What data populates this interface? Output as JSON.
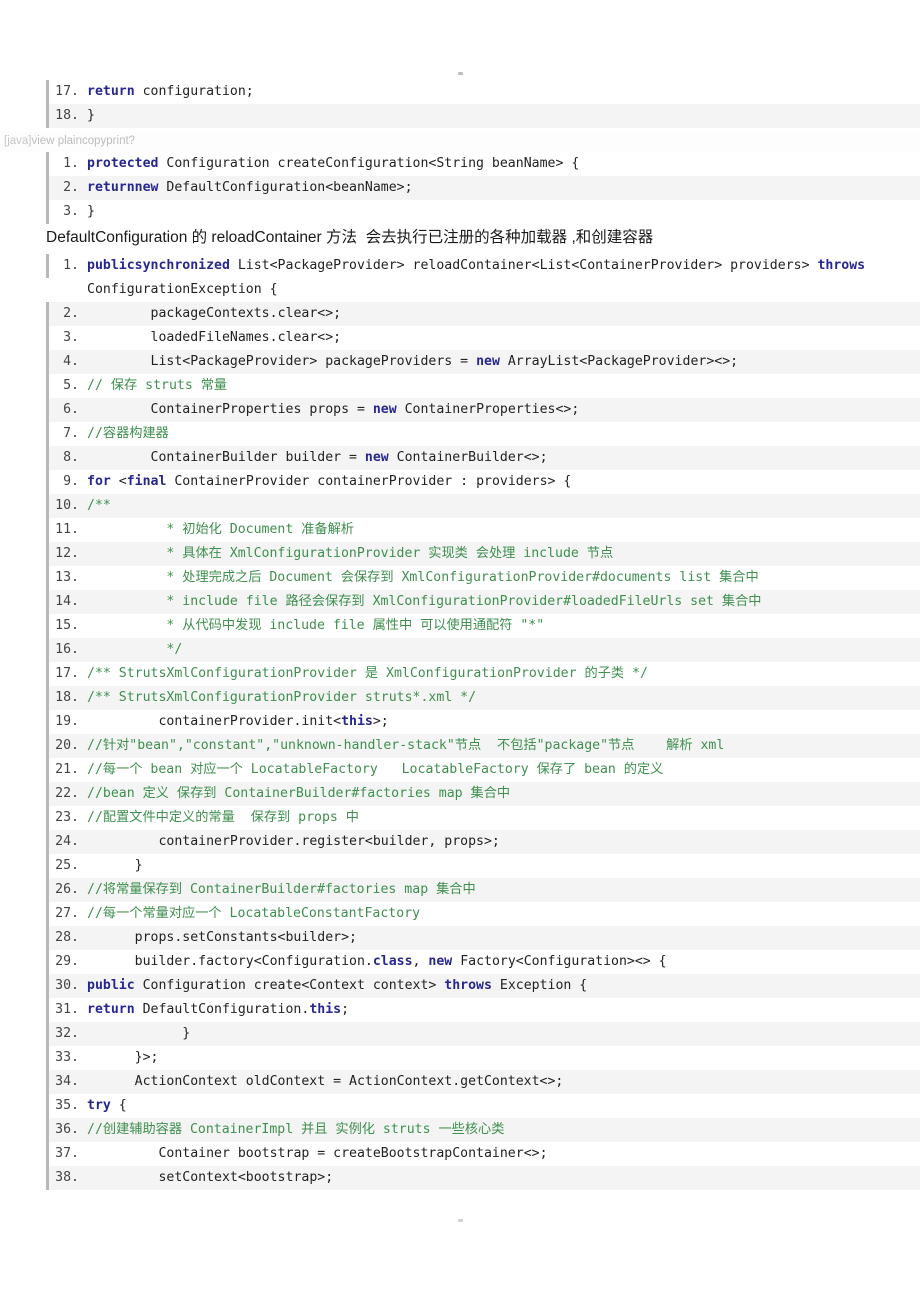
{
  "page": {
    "artifact_top": "·",
    "artifact_bottom": "·"
  },
  "block_a": {
    "rows": [
      {
        "n": "17.",
        "parts": [
          {
            "t": "kw",
            "s": "return"
          },
          {
            "t": "pl",
            "s": " configuration;"
          }
        ]
      },
      {
        "n": "18.",
        "parts": [
          {
            "t": "pl",
            "s": "}"
          }
        ]
      }
    ]
  },
  "toolbar": {
    "lang_label": "[java]",
    "actions_label": "view plaincopyprint?"
  },
  "block_b": {
    "rows": [
      {
        "n": "1.",
        "parts": [
          {
            "t": "kw",
            "s": "protected"
          },
          {
            "t": "pl",
            "s": " Configuration createConfiguration<String beanName> {"
          }
        ]
      },
      {
        "n": "2.",
        "parts": [
          {
            "t": "kw",
            "s": "returnnew"
          },
          {
            "t": "pl",
            "s": " DefaultConfiguration<beanName>;"
          }
        ]
      },
      {
        "n": "3.",
        "parts": [
          {
            "t": "pl",
            "s": "}"
          }
        ]
      }
    ]
  },
  "paragraph": {
    "text": "DefaultConfiguration 的 reloadContainer 方法  会去执行已注册的各种加载器 ,和创建容器"
  },
  "block_c": {
    "rows": [
      {
        "n": "1.",
        "parts": [
          {
            "t": "kw",
            "s": "publicsynchronized"
          },
          {
            "t": "pl",
            "s": " List<PackageProvider> reloadContainer<List<ContainerProvider> providers> "
          },
          {
            "t": "kw",
            "s": "throws"
          },
          {
            "t": "pl",
            "s": " ConfigurationException {"
          }
        ]
      },
      {
        "n": "2.",
        "parts": [
          {
            "t": "pl",
            "s": "        packageContexts.clear<>;"
          }
        ]
      },
      {
        "n": "3.",
        "parts": [
          {
            "t": "pl",
            "s": "        loadedFileNames.clear<>;"
          }
        ]
      },
      {
        "n": "4.",
        "parts": [
          {
            "t": "pl",
            "s": "        List<PackageProvider> packageProviders = "
          },
          {
            "t": "kw",
            "s": "new"
          },
          {
            "t": "pl",
            "s": " ArrayList<PackageProvider><>;"
          }
        ]
      },
      {
        "n": "5.",
        "parts": [
          {
            "t": "cm",
            "s": "// 保存 struts 常量"
          }
        ]
      },
      {
        "n": "6.",
        "parts": [
          {
            "t": "pl",
            "s": "        ContainerProperties props = "
          },
          {
            "t": "kw",
            "s": "new"
          },
          {
            "t": "pl",
            "s": " ContainerProperties<>;"
          }
        ]
      },
      {
        "n": "7.",
        "parts": [
          {
            "t": "cm",
            "s": "//容器构建器"
          }
        ]
      },
      {
        "n": "8.",
        "parts": [
          {
            "t": "pl",
            "s": "        ContainerBuilder builder = "
          },
          {
            "t": "kw",
            "s": "new"
          },
          {
            "t": "pl",
            "s": " ContainerBuilder<>;"
          }
        ]
      },
      {
        "n": "9.",
        "parts": [
          {
            "t": "kw",
            "s": "for"
          },
          {
            "t": "pl",
            "s": " <"
          },
          {
            "t": "kw",
            "s": "final"
          },
          {
            "t": "pl",
            "s": " ContainerProvider containerProvider : providers> {"
          }
        ]
      },
      {
        "n": "10.",
        "parts": [
          {
            "t": "cm",
            "s": "/**"
          }
        ]
      },
      {
        "n": "11.",
        "parts": [
          {
            "t": "cm",
            "s": "          * 初始化 Document 准备解析"
          }
        ]
      },
      {
        "n": "12.",
        "parts": [
          {
            "t": "cm",
            "s": "          * 具体在 XmlConfigurationProvider 实现类 会处理 include 节点"
          }
        ]
      },
      {
        "n": "13.",
        "parts": [
          {
            "t": "cm",
            "s": "          * 处理完成之后 Document 会保存到 XmlConfigurationProvider#documents list 集合中"
          }
        ]
      },
      {
        "n": "14.",
        "parts": [
          {
            "t": "cm",
            "s": "          * include file 路径会保存到 XmlConfigurationProvider#loadedFileUrls set 集合中"
          }
        ]
      },
      {
        "n": "15.",
        "parts": [
          {
            "t": "cm",
            "s": "          * 从代码中发现 include file 属性中 可以使用通配符 \"*\""
          }
        ]
      },
      {
        "n": "16.",
        "parts": [
          {
            "t": "cm",
            "s": "          */"
          }
        ]
      },
      {
        "n": "17.",
        "parts": [
          {
            "t": "cm",
            "s": "/** StrutsXmlConfigurationProvider 是 XmlConfigurationProvider 的子类 */"
          }
        ]
      },
      {
        "n": "18.",
        "parts": [
          {
            "t": "cm",
            "s": "/** StrutsXmlConfigurationProvider struts*.xml */"
          }
        ]
      },
      {
        "n": "19.",
        "parts": [
          {
            "t": "pl",
            "s": "         containerProvider.init<"
          },
          {
            "t": "kw",
            "s": "this"
          },
          {
            "t": "pl",
            "s": ">;"
          }
        ]
      },
      {
        "n": "20.",
        "parts": [
          {
            "t": "cm",
            "s": "//针对\"bean\",\"constant\",\"unknown-handler-stack\"节点  不包括\"package\"节点    解析 xml"
          }
        ]
      },
      {
        "n": "21.",
        "parts": [
          {
            "t": "cm",
            "s": "//每一个 bean 对应一个 LocatableFactory   LocatableFactory 保存了 bean 的定义"
          }
        ]
      },
      {
        "n": "22.",
        "parts": [
          {
            "t": "cm",
            "s": "//bean 定义 保存到 ContainerBuilder#factories map 集合中"
          }
        ]
      },
      {
        "n": "23.",
        "parts": [
          {
            "t": "cm",
            "s": "//配置文件中定义的常量  保存到 props 中"
          }
        ]
      },
      {
        "n": "24.",
        "parts": [
          {
            "t": "pl",
            "s": "         containerProvider.register<builder, props>;"
          }
        ]
      },
      {
        "n": "25.",
        "parts": [
          {
            "t": "pl",
            "s": "      }"
          }
        ]
      },
      {
        "n": "26.",
        "parts": [
          {
            "t": "cm",
            "s": "//将常量保存到 ContainerBuilder#factories map 集合中"
          }
        ]
      },
      {
        "n": "27.",
        "parts": [
          {
            "t": "cm",
            "s": "//每一个常量对应一个 LocatableConstantFactory"
          }
        ]
      },
      {
        "n": "28.",
        "parts": [
          {
            "t": "pl",
            "s": "      props.setConstants<builder>;"
          }
        ]
      },
      {
        "n": "29.",
        "parts": [
          {
            "t": "pl",
            "s": "      builder.factory<Configuration."
          },
          {
            "t": "kw",
            "s": "class"
          },
          {
            "t": "pl",
            "s": ", "
          },
          {
            "t": "kw",
            "s": "new"
          },
          {
            "t": "pl",
            "s": " Factory<Configuration><> {"
          }
        ]
      },
      {
        "n": "30.",
        "parts": [
          {
            "t": "kw",
            "s": "public"
          },
          {
            "t": "pl",
            "s": " Configuration create<Context context> "
          },
          {
            "t": "kw",
            "s": "throws"
          },
          {
            "t": "pl",
            "s": " Exception {"
          }
        ]
      },
      {
        "n": "31.",
        "parts": [
          {
            "t": "kw",
            "s": "return"
          },
          {
            "t": "pl",
            "s": " DefaultConfiguration."
          },
          {
            "t": "kw",
            "s": "this"
          },
          {
            "t": "pl",
            "s": ";"
          }
        ]
      },
      {
        "n": "32.",
        "parts": [
          {
            "t": "pl",
            "s": "            }"
          }
        ]
      },
      {
        "n": "33.",
        "parts": [
          {
            "t": "pl",
            "s": "      }>;"
          }
        ]
      },
      {
        "n": "34.",
        "parts": [
          {
            "t": "pl",
            "s": "      ActionContext oldContext = ActionContext.getContext<>;"
          }
        ]
      },
      {
        "n": "35.",
        "parts": [
          {
            "t": "kw",
            "s": "try"
          },
          {
            "t": "pl",
            "s": " {"
          }
        ]
      },
      {
        "n": "36.",
        "parts": [
          {
            "t": "cm",
            "s": "//创建辅助容器 ContainerImpl 并且 实例化 struts 一些核心类"
          }
        ]
      },
      {
        "n": "37.",
        "parts": [
          {
            "t": "pl",
            "s": "         Container bootstrap = createBootstrapContainer<>;"
          }
        ]
      },
      {
        "n": "38.",
        "parts": [
          {
            "t": "pl",
            "s": "         setContext<bootstrap>;"
          }
        ]
      }
    ]
  }
}
